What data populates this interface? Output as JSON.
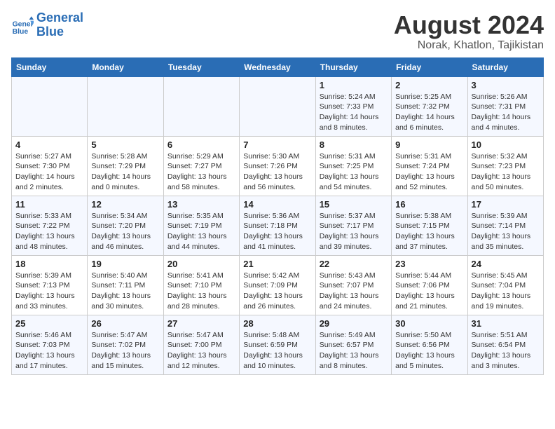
{
  "header": {
    "logo_line1": "General",
    "logo_line2": "Blue",
    "month_year": "August 2024",
    "location": "Norak, Khatlon, Tajikistan"
  },
  "weekdays": [
    "Sunday",
    "Monday",
    "Tuesday",
    "Wednesday",
    "Thursday",
    "Friday",
    "Saturday"
  ],
  "weeks": [
    [
      {
        "day": "",
        "info": ""
      },
      {
        "day": "",
        "info": ""
      },
      {
        "day": "",
        "info": ""
      },
      {
        "day": "",
        "info": ""
      },
      {
        "day": "1",
        "info": "Sunrise: 5:24 AM\nSunset: 7:33 PM\nDaylight: 14 hours\nand 8 minutes."
      },
      {
        "day": "2",
        "info": "Sunrise: 5:25 AM\nSunset: 7:32 PM\nDaylight: 14 hours\nand 6 minutes."
      },
      {
        "day": "3",
        "info": "Sunrise: 5:26 AM\nSunset: 7:31 PM\nDaylight: 14 hours\nand 4 minutes."
      }
    ],
    [
      {
        "day": "4",
        "info": "Sunrise: 5:27 AM\nSunset: 7:30 PM\nDaylight: 14 hours\nand 2 minutes."
      },
      {
        "day": "5",
        "info": "Sunrise: 5:28 AM\nSunset: 7:29 PM\nDaylight: 14 hours\nand 0 minutes."
      },
      {
        "day": "6",
        "info": "Sunrise: 5:29 AM\nSunset: 7:27 PM\nDaylight: 13 hours\nand 58 minutes."
      },
      {
        "day": "7",
        "info": "Sunrise: 5:30 AM\nSunset: 7:26 PM\nDaylight: 13 hours\nand 56 minutes."
      },
      {
        "day": "8",
        "info": "Sunrise: 5:31 AM\nSunset: 7:25 PM\nDaylight: 13 hours\nand 54 minutes."
      },
      {
        "day": "9",
        "info": "Sunrise: 5:31 AM\nSunset: 7:24 PM\nDaylight: 13 hours\nand 52 minutes."
      },
      {
        "day": "10",
        "info": "Sunrise: 5:32 AM\nSunset: 7:23 PM\nDaylight: 13 hours\nand 50 minutes."
      }
    ],
    [
      {
        "day": "11",
        "info": "Sunrise: 5:33 AM\nSunset: 7:22 PM\nDaylight: 13 hours\nand 48 minutes."
      },
      {
        "day": "12",
        "info": "Sunrise: 5:34 AM\nSunset: 7:20 PM\nDaylight: 13 hours\nand 46 minutes."
      },
      {
        "day": "13",
        "info": "Sunrise: 5:35 AM\nSunset: 7:19 PM\nDaylight: 13 hours\nand 44 minutes."
      },
      {
        "day": "14",
        "info": "Sunrise: 5:36 AM\nSunset: 7:18 PM\nDaylight: 13 hours\nand 41 minutes."
      },
      {
        "day": "15",
        "info": "Sunrise: 5:37 AM\nSunset: 7:17 PM\nDaylight: 13 hours\nand 39 minutes."
      },
      {
        "day": "16",
        "info": "Sunrise: 5:38 AM\nSunset: 7:15 PM\nDaylight: 13 hours\nand 37 minutes."
      },
      {
        "day": "17",
        "info": "Sunrise: 5:39 AM\nSunset: 7:14 PM\nDaylight: 13 hours\nand 35 minutes."
      }
    ],
    [
      {
        "day": "18",
        "info": "Sunrise: 5:39 AM\nSunset: 7:13 PM\nDaylight: 13 hours\nand 33 minutes."
      },
      {
        "day": "19",
        "info": "Sunrise: 5:40 AM\nSunset: 7:11 PM\nDaylight: 13 hours\nand 30 minutes."
      },
      {
        "day": "20",
        "info": "Sunrise: 5:41 AM\nSunset: 7:10 PM\nDaylight: 13 hours\nand 28 minutes."
      },
      {
        "day": "21",
        "info": "Sunrise: 5:42 AM\nSunset: 7:09 PM\nDaylight: 13 hours\nand 26 minutes."
      },
      {
        "day": "22",
        "info": "Sunrise: 5:43 AM\nSunset: 7:07 PM\nDaylight: 13 hours\nand 24 minutes."
      },
      {
        "day": "23",
        "info": "Sunrise: 5:44 AM\nSunset: 7:06 PM\nDaylight: 13 hours\nand 21 minutes."
      },
      {
        "day": "24",
        "info": "Sunrise: 5:45 AM\nSunset: 7:04 PM\nDaylight: 13 hours\nand 19 minutes."
      }
    ],
    [
      {
        "day": "25",
        "info": "Sunrise: 5:46 AM\nSunset: 7:03 PM\nDaylight: 13 hours\nand 17 minutes."
      },
      {
        "day": "26",
        "info": "Sunrise: 5:47 AM\nSunset: 7:02 PM\nDaylight: 13 hours\nand 15 minutes."
      },
      {
        "day": "27",
        "info": "Sunrise: 5:47 AM\nSunset: 7:00 PM\nDaylight: 13 hours\nand 12 minutes."
      },
      {
        "day": "28",
        "info": "Sunrise: 5:48 AM\nSunset: 6:59 PM\nDaylight: 13 hours\nand 10 minutes."
      },
      {
        "day": "29",
        "info": "Sunrise: 5:49 AM\nSunset: 6:57 PM\nDaylight: 13 hours\nand 8 minutes."
      },
      {
        "day": "30",
        "info": "Sunrise: 5:50 AM\nSunset: 6:56 PM\nDaylight: 13 hours\nand 5 minutes."
      },
      {
        "day": "31",
        "info": "Sunrise: 5:51 AM\nSunset: 6:54 PM\nDaylight: 13 hours\nand 3 minutes."
      }
    ]
  ]
}
